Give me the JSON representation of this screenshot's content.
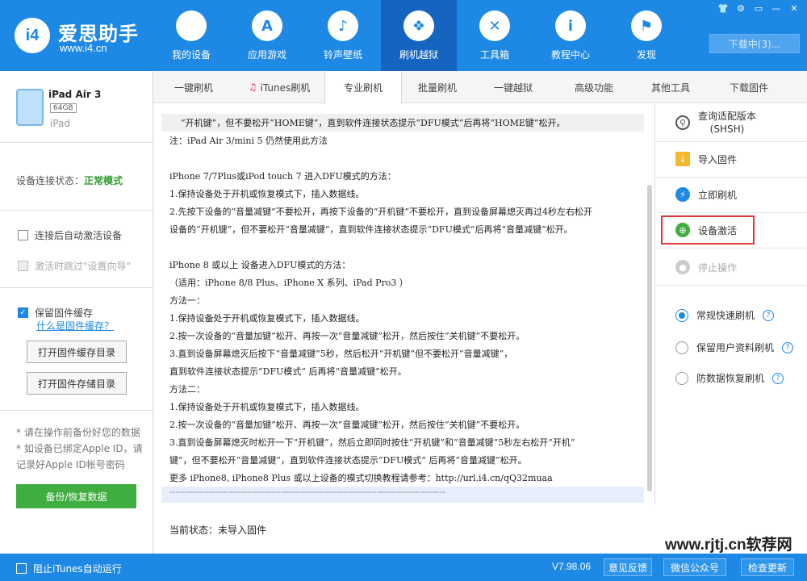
{
  "app": {
    "logo_glyph": "i4",
    "title": "爱思助手",
    "url": "www.i4.cn"
  },
  "nav": [
    {
      "icon": "apple-icon",
      "glyph": "",
      "label": "我的设备"
    },
    {
      "icon": "appstore-icon",
      "glyph": "A",
      "label": "应用游戏"
    },
    {
      "icon": "music-icon",
      "glyph": "♪",
      "label": "铃声壁纸"
    },
    {
      "icon": "dropbox-icon",
      "glyph": "❖",
      "label": "刷机越狱"
    },
    {
      "icon": "tools-icon",
      "glyph": "✕",
      "label": "工具箱"
    },
    {
      "icon": "info-icon",
      "glyph": "i",
      "label": "教程中心"
    },
    {
      "icon": "flag-icon",
      "glyph": "⚑",
      "label": "发现"
    }
  ],
  "download_label": "下载中(3)...",
  "device": {
    "name": "iPad Air 3",
    "capacity": "64GB",
    "type": "iPad",
    "conn_label": "设备连接状态：",
    "conn_value": "正常模式"
  },
  "left": {
    "auto_activate": "连接后自动激活设备",
    "skip_setup": "激活时跳过\"设置向导\"",
    "keep_cache": "保留固件缓存",
    "what_cache": "什么是固件缓存？",
    "open_cache_dir": "打开固件缓存目录",
    "open_store_dir": "打开固件存储目录",
    "note1": "* 请在操作前备份好您的数据",
    "note2": "* 如设备已绑定Apple ID，请记录好Apple ID帐号密码",
    "backup_btn": "备份/恢复数据"
  },
  "tabs": [
    "一键刷机",
    "iTunes刷机",
    "专业刷机",
    "批量刷机",
    "一键越狱",
    "高级功能",
    "其他工具",
    "下载固件"
  ],
  "content": {
    "lines": [
      "“开机键”，但不要松开“HOME键”，直到软件连接状态提示“DFU模式”后再将“HOME键”松开。",
      "注：iPad Air 3/mini 5 仍然使用此方法",
      "",
      "iPhone 7/7Plus或iPod touch 7 进入DFU模式的方法：",
      "1.保持设备处于开机或恢复模式下，插入数据线。",
      "2.先按下设备的“音量减键”不要松开，再按下设备的“开机键”不要松开，直到设备屏幕熄灭再过4秒左右松开",
      "  设备的“开机键”，但不要松开“音量减键”，直到软件连接状态提示“DFU模式”后再将“音量减键”松开。",
      "",
      "iPhone 8 或以上 设备进入DFU模式的方法：",
      "（适用：iPhone 8/8 Plus、iPhone X 系列、iPad Pro3 ）",
      "方法一：",
      "1.保持设备处于开机或恢复模式下，插入数据线。",
      "2.按一次设备的“音量加键”松开、再按一次“音量减键”松开，然后按住“关机键”不要松开。",
      "3.直到设备屏幕熄灭后按下“音量减键”5秒，然后松开“开机键”但不要松开“音量减键”，",
      "直到软件连接状态提示“DFU模式“ 后再将“音量减键”松开。",
      "方法二：",
      "1.保持设备处于开机或恢复模式下，插入数据线。",
      "2.按一次设备的“音量加键”松开、再按一次“音量减键”松开，然后按住“关机键”不要松开。",
      "3.直到设备屏幕熄灭时松开一下“开机键”，然后立即同时按住“开机键”和“音量减键”5秒左右松开“开机”",
      "  键”，但不要松开“音量减键”，直到软件连接状态提示“DFU模式“ 后再将“音量减键”松开。",
      "更多 iPhone8, iPhone8 Plus 或以上设备的模式切换教程请参考：http://url.i4.cn/qQ32muaa",
      "--------------------------------------------------------------------------------------------"
    ],
    "status": "当前状态：未导入固件"
  },
  "right": {
    "query_line1": "查询适配版本",
    "query_line2": "(SHSH)",
    "import_fw": "导入固件",
    "flash_now": "立即刷机",
    "activate": "设备激活",
    "stop": "停止操作",
    "mode_fast": "常规快速刷机",
    "mode_keep": "保留用户资料刷机",
    "mode_recover": "防数据恢复刷机"
  },
  "footer": {
    "block_itunes": "阻止iTunes自动运行",
    "version": "V7.98.06",
    "feedback": "意见反馈",
    "wechat": "微信公众号",
    "check_update": "检查更新"
  },
  "watermark": "www.rjtj.cn软荐网",
  "colors": {
    "brand": "#1e88e5",
    "success": "#3fae3f",
    "highlight_box": "#e53935"
  }
}
